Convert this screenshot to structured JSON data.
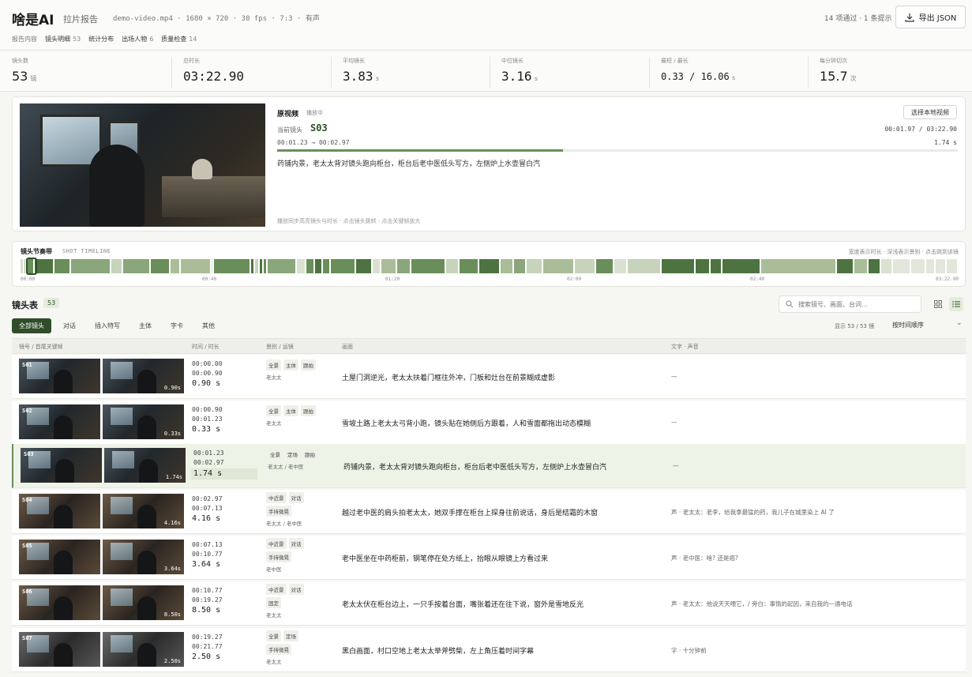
{
  "header": {
    "logo": "啥是AI",
    "subtitle": "拉片报告",
    "meta": "demo-video.mp4 · 1680 × 720 · 30 fps · 7:3 · 有声",
    "status": "14 项通过 · 1 条提示",
    "export_label": "导出 JSON",
    "nav": [
      {
        "label": "报告内容",
        "count": ""
      },
      {
        "label": "镜头明细",
        "count": "53"
      },
      {
        "label": "统计分布",
        "count": ""
      },
      {
        "label": "出场人物",
        "count": "6"
      },
      {
        "label": "质量检查",
        "count": "14"
      }
    ]
  },
  "stats": [
    {
      "label": "镜头数",
      "value": "53",
      "unit": "镜"
    },
    {
      "label": "总时长",
      "value": "03:22.90",
      "unit": ""
    },
    {
      "label": "平均镜长",
      "value": "3.83",
      "unit": "s"
    },
    {
      "label": "中位镜长",
      "value": "3.16",
      "unit": "s"
    },
    {
      "label": "最短 / 最长",
      "value": "0.33 / 16.06",
      "unit": "s"
    },
    {
      "label": "每分钟切次",
      "value": "15.7",
      "unit": "次"
    }
  ],
  "player": {
    "title": "原视频",
    "state": "播放中",
    "current_label": "当前镜头",
    "current_id": "S03",
    "range": "00:01.23 → 00:02.97",
    "time": "00:01.97 / 03:22.90",
    "duration": "1.74 s",
    "progress": 0.42,
    "description": "药铺内景，老太太背对镜头跑向柜台，柜台后老中医低头写方，左侧炉上水壶冒白汽",
    "hint": "播放同步高亮镜头与时长 · 点击镜头跳转 · 点击关键帧放大",
    "select_label": "选择本地视频"
  },
  "timeline": {
    "title": "镜头节奏带",
    "subtitle": "SHOT TIMELINE",
    "hint": "宽度表示时长 · 深浅表示景别 · 点击跳到该镜",
    "ticks": [
      "00:00",
      "00:40",
      "01:20",
      "02:00",
      "02:40",
      "03:22.90"
    ],
    "segments": [
      {
        "d": 0.9,
        "c": "#d9e1d0"
      },
      {
        "d": 0.33,
        "c": "#a9bd99"
      },
      {
        "d": 1.74,
        "c": "#6a8e5a"
      },
      {
        "d": 4.16,
        "c": "#4d7340"
      },
      {
        "d": 3.64,
        "c": "#6a8e5a"
      },
      {
        "d": 8.5,
        "c": "#8aa67a"
      },
      {
        "d": 2.5,
        "c": "#c7d4bb"
      },
      {
        "d": 5.8,
        "c": "#8aa67a"
      },
      {
        "d": 4.2,
        "c": "#6a8e5a"
      },
      {
        "d": 2.1,
        "c": "#a9bd99"
      },
      {
        "d": 6.5,
        "c": "#a9bd99"
      },
      {
        "d": 0.6,
        "c": "#d9e1d0"
      },
      {
        "d": 7.8,
        "c": "#6a8e5a"
      },
      {
        "d": 0.9,
        "c": "#4d7340"
      },
      {
        "d": 0.9,
        "c": "#c7d4bb"
      },
      {
        "d": 0.9,
        "c": "#4d7340"
      },
      {
        "d": 0.9,
        "c": "#6a8e5a"
      },
      {
        "d": 6.2,
        "c": "#8aa67a"
      },
      {
        "d": 2.0,
        "c": "#d9e1d0"
      },
      {
        "d": 1.7,
        "c": "#6a8e5a"
      },
      {
        "d": 1.7,
        "c": "#4d7340"
      },
      {
        "d": 1.7,
        "c": "#6a8e5a"
      },
      {
        "d": 5.3,
        "c": "#6a8e5a"
      },
      {
        "d": 3.5,
        "c": "#4d7340"
      },
      {
        "d": 1.9,
        "c": "#d9e1d0"
      },
      {
        "d": 3.4,
        "c": "#a9bd99"
      },
      {
        "d": 3.0,
        "c": "#8aa67a"
      },
      {
        "d": 7.3,
        "c": "#6a8e5a"
      },
      {
        "d": 2.8,
        "c": "#c7d4bb"
      },
      {
        "d": 4.2,
        "c": "#6a8e5a"
      },
      {
        "d": 4.5,
        "c": "#4d7340"
      },
      {
        "d": 2.8,
        "c": "#a9bd99"
      },
      {
        "d": 2.8,
        "c": "#8aa67a"
      },
      {
        "d": 3.5,
        "c": "#c7d4bb"
      },
      {
        "d": 6.6,
        "c": "#a9bd99"
      },
      {
        "d": 4.6,
        "c": "#c7d4bb"
      },
      {
        "d": 3.8,
        "c": "#6a8e5a"
      },
      {
        "d": 2.8,
        "c": "#d9e1d0"
      },
      {
        "d": 7.2,
        "c": "#c7d4bb"
      },
      {
        "d": 7.2,
        "c": "#4d7340"
      },
      {
        "d": 3.2,
        "c": "#4d7340"
      },
      {
        "d": 2.5,
        "c": "#4d7340"
      },
      {
        "d": 8.1,
        "c": "#4d7340"
      },
      {
        "d": 16.06,
        "c": "#a9bd99"
      },
      {
        "d": 3.7,
        "c": "#4d7340"
      },
      {
        "d": 3.0,
        "c": "#a9bd99"
      },
      {
        "d": 2.7,
        "c": "#4d7340"
      },
      {
        "d": 2.5,
        "c": "#d9e1d0"
      },
      {
        "d": 3.8,
        "c": "#e1e7da"
      },
      {
        "d": 3.2,
        "c": "#e1e7da"
      },
      {
        "d": 2.0,
        "c": "#e1e7da"
      },
      {
        "d": 2.4,
        "c": "#e1e7da"
      },
      {
        "d": 2.5,
        "c": "#e1e7da"
      }
    ]
  },
  "table": {
    "title": "镜头表",
    "count": "53",
    "search_placeholder": "搜索镜号、画面、台词…",
    "filters": [
      "全部镜头",
      "对话",
      "插入特写",
      "主体",
      "字卡",
      "其他"
    ],
    "status": "显示 53 / 53 镜",
    "sort": "按时间顺序",
    "columns": [
      "镜号 / 首尾关键帧",
      "时间 / 时长",
      "景别 / 运镜",
      "画面",
      "文字 · 声音"
    ],
    "rows": [
      {
        "id": "S01",
        "dur_badge": "0.90s",
        "start": "00:00.00",
        "end": "00:00.90",
        "dur": "0.90 s",
        "tags1": [
          "全景",
          "主体",
          "跟拍"
        ],
        "tags2": [],
        "chars": "老太太",
        "scene": "土屋门洞逆光，老太太扶着门框往外冲，门板和灶台在前景糊成虚影",
        "text": "—"
      },
      {
        "id": "S02",
        "dur_badge": "0.33s",
        "start": "00:00.90",
        "end": "00:01.23",
        "dur": "0.33 s",
        "tags1": [
          "全景",
          "主体",
          "跟拍"
        ],
        "tags2": [],
        "chars": "老太太",
        "scene": "雪坡土路上老太太弓背小跑，镜头贴在她侧后方跟着，人和雪面都拖出动态模糊",
        "text": "—"
      },
      {
        "id": "S03",
        "dur_badge": "1.74s",
        "start": "00:01.23",
        "end": "00:02.97",
        "dur": "1.74 s",
        "tags1": [
          "全景",
          "定场",
          "跟拍"
        ],
        "tags2": [],
        "chars": "老太太 / 老中医",
        "scene": "药铺内景，老太太背对镜头跑向柜台，柜台后老中医低头写方，左侧炉上水壶冒白汽",
        "text": "—"
      },
      {
        "id": "S04",
        "dur_badge": "4.16s",
        "start": "00:02.97",
        "end": "00:07.13",
        "dur": "4.16 s",
        "tags1": [
          "中近景",
          "对话"
        ],
        "tags2": [
          "手持微晃"
        ],
        "chars": "老太太 / 老中医",
        "scene": "越过老中医的肩头拍老太太，她双手撑在柜台上探身往前说话，身后是结霜的木窗",
        "text": "声 · 老太太：老李，给我拿最猛的药，我儿子在城里染上 AI 了"
      },
      {
        "id": "S05",
        "dur_badge": "3.64s",
        "start": "00:07.13",
        "end": "00:10.77",
        "dur": "3.64 s",
        "tags1": [
          "中近景",
          "对话"
        ],
        "tags2": [
          "手持微晃"
        ],
        "chars": "老中医",
        "scene": "老中医坐在中药柜前，钢笔停在处方纸上，抬眼从眼镜上方看过来",
        "text": "声 · 老中医：啥? 还是癌?"
      },
      {
        "id": "S06",
        "dur_badge": "8.50s",
        "start": "00:10.77",
        "end": "00:19.27",
        "dur": "8.50 s",
        "tags1": [
          "中近景",
          "对话"
        ],
        "tags2": [
          "固定"
        ],
        "chars": "老太太",
        "scene": "老太太伏在柜台边上，一只手按着台面，嘴张着还在往下说，窗外是雪地反光",
        "text": "声 · 老太太：他说天天喂它，/ 旁白：事情的起因，来自我的一通电话"
      },
      {
        "id": "S07",
        "dur_badge": "2.50s",
        "start": "00:19.27",
        "end": "00:21.77",
        "dur": "2.50 s",
        "tags1": [
          "全景",
          "定场"
        ],
        "tags2": [
          "手持微晃"
        ],
        "chars": "老太太",
        "scene": "黑白画面，村口空地上老太太举斧劈柴，左上角压着时间字幕",
        "text": "字 · 十分钟前"
      }
    ]
  },
  "colors": {
    "accent": "#2f4d2a",
    "highlight": "#eef3e8"
  },
  "icons": [
    "download-icon",
    "search-icon",
    "grid-view-icon",
    "list-view-icon",
    "chevron-down-icon"
  ]
}
